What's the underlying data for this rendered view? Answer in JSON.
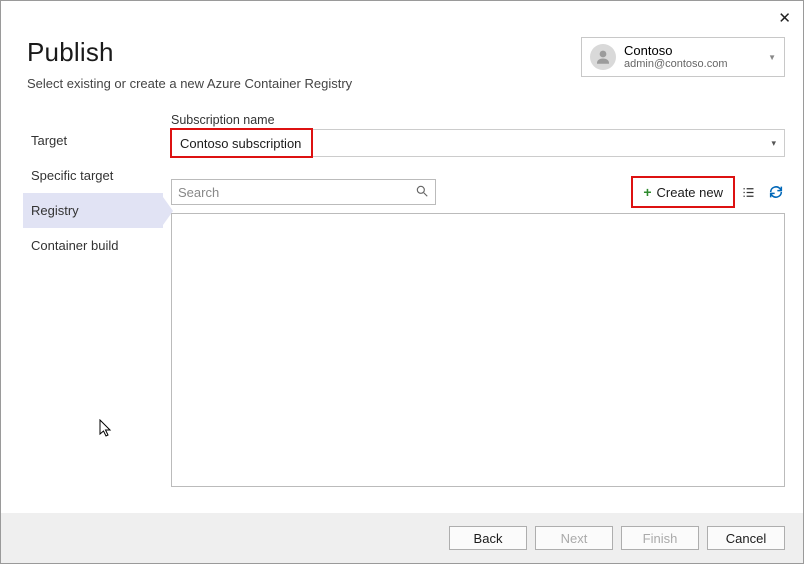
{
  "window": {
    "close": "✕"
  },
  "header": {
    "title": "Publish",
    "subtitle": "Select existing or create a new Azure Container Registry"
  },
  "account": {
    "name": "Contoso",
    "email": "admin@contoso.com"
  },
  "sidebar": {
    "items": [
      {
        "label": "Target"
      },
      {
        "label": "Specific target"
      },
      {
        "label": "Registry"
      },
      {
        "label": "Container build"
      }
    ],
    "active_index": 2
  },
  "form": {
    "subscription_label": "Subscription name",
    "subscription_value": "Contoso subscription",
    "search_placeholder": "Search",
    "create_new_label": "Create new"
  },
  "footer": {
    "back": "Back",
    "next": "Next",
    "finish": "Finish",
    "cancel": "Cancel"
  }
}
